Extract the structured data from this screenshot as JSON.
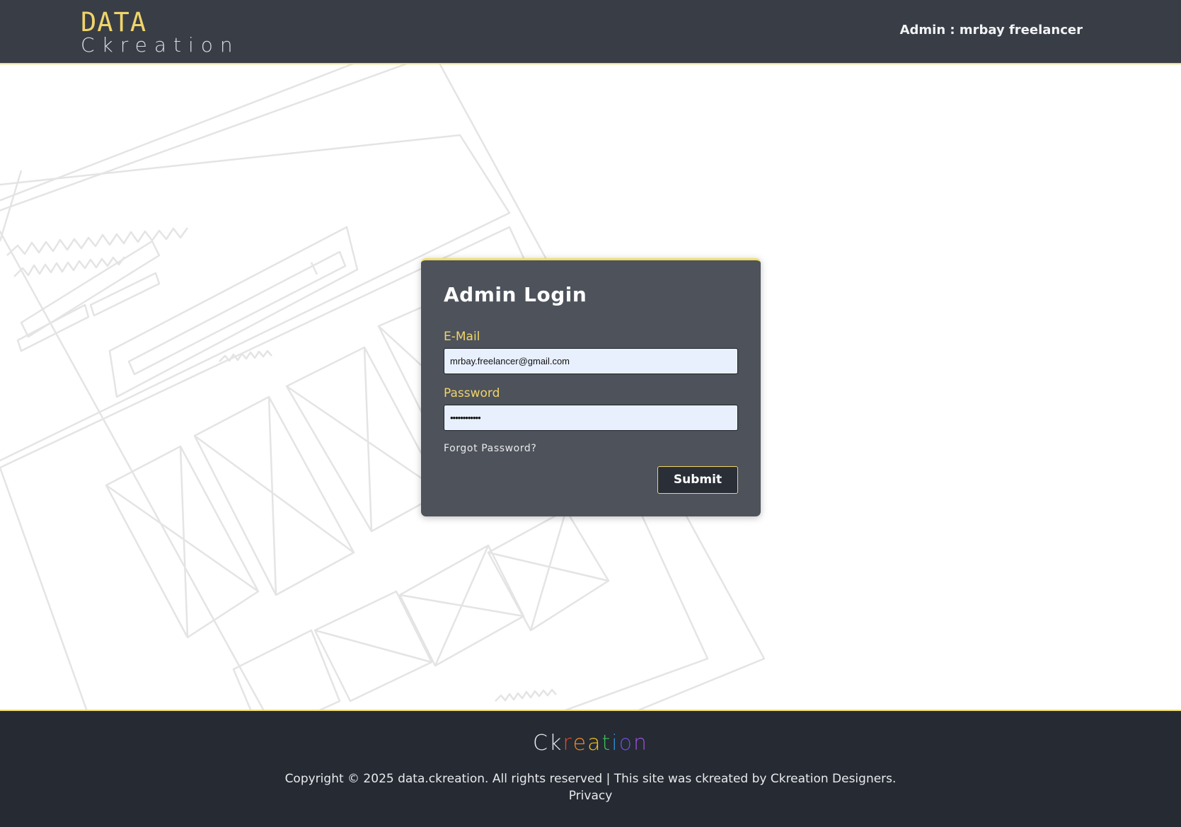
{
  "header": {
    "logo_line1": "DATA",
    "logo_line2": "Ckreation",
    "admin_label": "Admin : mrbay freelancer"
  },
  "login": {
    "title": "Admin Login",
    "email_label": "E-Mail",
    "email_value": "mrbay.freelancer@gmail.com",
    "password_label": "Password",
    "password_value": "••••••••••••",
    "forgot_label": "Forgot Password?",
    "submit_label": "Submit"
  },
  "footer": {
    "logo_letters": [
      "C",
      "k",
      "r",
      "e",
      "a",
      "t",
      "i",
      "o",
      "n"
    ],
    "logo_colors": [
      "#e9eaec",
      "#e9eaec",
      "#e04b2b",
      "#f08a24",
      "#f2c21b",
      "#3fbf5b",
      "#2f8fd8",
      "#6a4fd6",
      "#9a4fd6"
    ],
    "copyright": "Copyright © 2025 data.ckreation. All rights reserved | This site was ckreated by Ckreation Designers.",
    "privacy": "Privacy"
  },
  "colors": {
    "header_bg": "#393d46",
    "accent": "#f0d46a",
    "card_bg": "#4d525b",
    "footer_bg": "#252a33",
    "input_bg": "#e8f0fe"
  }
}
